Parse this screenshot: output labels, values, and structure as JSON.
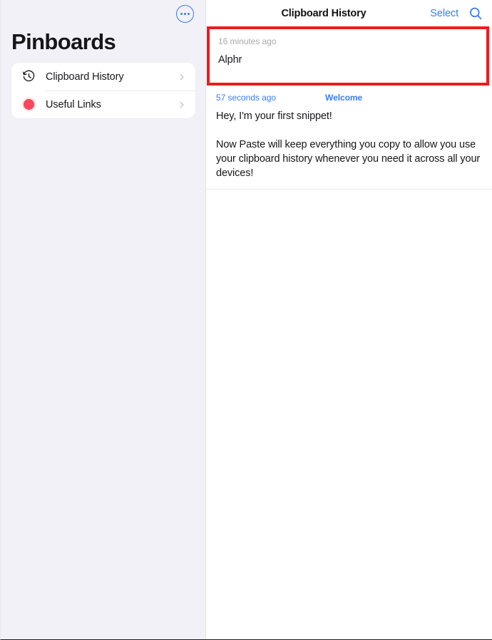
{
  "sidebar": {
    "more_button": "more-options",
    "title": "Pinboards",
    "items": [
      {
        "label": "Clipboard History",
        "icon": "history-clock-icon"
      },
      {
        "label": "Useful Links",
        "icon": "red-dot-icon"
      }
    ]
  },
  "main": {
    "header": {
      "title": "Clipboard History",
      "select_label": "Select",
      "search_icon": "search-icon"
    },
    "entries": [
      {
        "time": "16 minutes ago",
        "tag": "",
        "body": "Alphr",
        "highlighted": true
      },
      {
        "time": "57 seconds ago",
        "tag": "Welcome",
        "body": "Hey, I'm your first snippet!\n\nNow Paste will keep everything you copy to allow you use your clipboard history whenever you need it across all your devices!",
        "highlighted": false
      }
    ]
  },
  "colors": {
    "accent_blue": "#3b7cf0",
    "highlight_red": "#ee1b1b",
    "pinboard_dot_red": "#f9475c",
    "sidebar_bg": "#f2f1f7",
    "muted_text": "#a9a9ae"
  }
}
